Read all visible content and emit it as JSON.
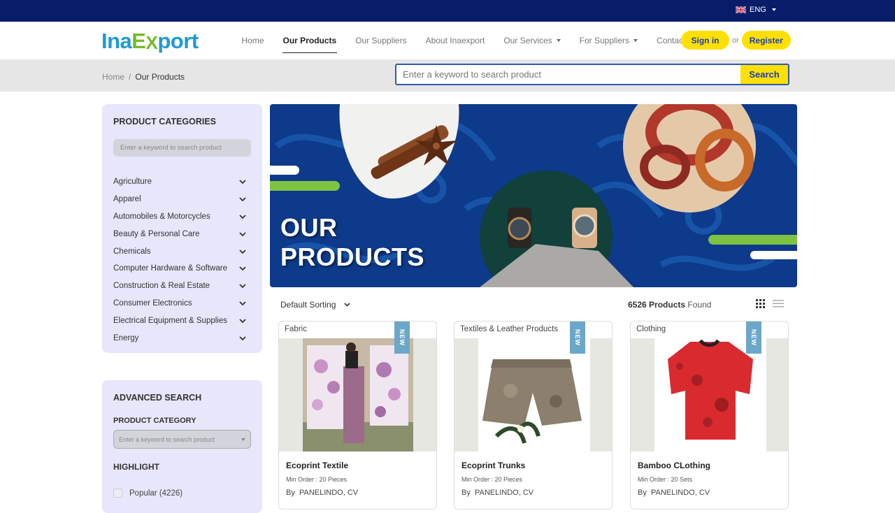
{
  "topbar": {
    "language": "ENG",
    "flag_icon": "uk-flag-icon"
  },
  "header": {
    "logo": {
      "part1": "Ina",
      "part2": "E",
      "part3": "X",
      "part4": "port"
    },
    "nav": [
      {
        "label": "Home"
      },
      {
        "label": "Our Products",
        "active": true
      },
      {
        "label": "Our Suppliers"
      },
      {
        "label": "About Inaexport"
      },
      {
        "label": "Our Services",
        "dropdown": true
      },
      {
        "label": "For Suppliers",
        "dropdown": true
      },
      {
        "label": "Contact Us"
      }
    ],
    "signin_label": "Sign in",
    "or_label": "or",
    "register_label": "Register"
  },
  "breadcrumb": {
    "home": "Home",
    "separator": "/",
    "current": "Our Products"
  },
  "search": {
    "placeholder": "Enter a keyword to search product",
    "button": "Search"
  },
  "sidebar": {
    "categories_title": "PRODUCT CATEGORIES",
    "categories_search_placeholder": "Enter a keyword to search product",
    "categories": [
      "Agriculture",
      "Apparel",
      "Automobiles & Motorcycles",
      "Beauty & Personal Care",
      "Chemicals",
      "Computer Hardware & Software",
      "Construction & Real Estate",
      "Consumer Electronics",
      "Electrical Equipment & Supplies",
      "Energy"
    ],
    "advanced_title": "ADVANCED SEARCH",
    "product_category_label": "PRODUCT CATEGORY",
    "product_category_placeholder": "Enter a keyword to search product",
    "highlight_title": "HIGHLIGHT",
    "highlight_options": [
      {
        "label": "Popular (4226)",
        "checked": false
      }
    ]
  },
  "banner": {
    "line1": "OUR",
    "line2": "PRODUCTS"
  },
  "toolbar": {
    "sort_label": "Default Sorting",
    "count": "6526 Products",
    "found_label": "Found",
    "view_icons": [
      "grid-view-icon",
      "list-view-icon"
    ]
  },
  "products": [
    {
      "category": "Fabric",
      "badge": "NEW",
      "name": "Ecoprint Textile",
      "min_order": "Min Order : 20 Pieces",
      "by": "By",
      "supplier": "PANELINDO, CV"
    },
    {
      "category": "Textiles & Leather Products",
      "badge": "NEW",
      "name": "Ecoprint Trunks",
      "min_order": "Min Order : 20 Pieces",
      "by": "By",
      "supplier": "PANELINDO, CV"
    },
    {
      "category": "Clothing",
      "badge": "NEW",
      "name": "Bamboo CLothing",
      "min_order": "Min Order : 20 Sets",
      "by": "By",
      "supplier": "PANELINDO, CV"
    }
  ],
  "colors": {
    "topbar": "#071d69",
    "accent_yellow": "#ffe000",
    "link_blue": "#1a3bb8",
    "panel_bg": "#e7e6fb",
    "badge": "#6ba7c8"
  }
}
